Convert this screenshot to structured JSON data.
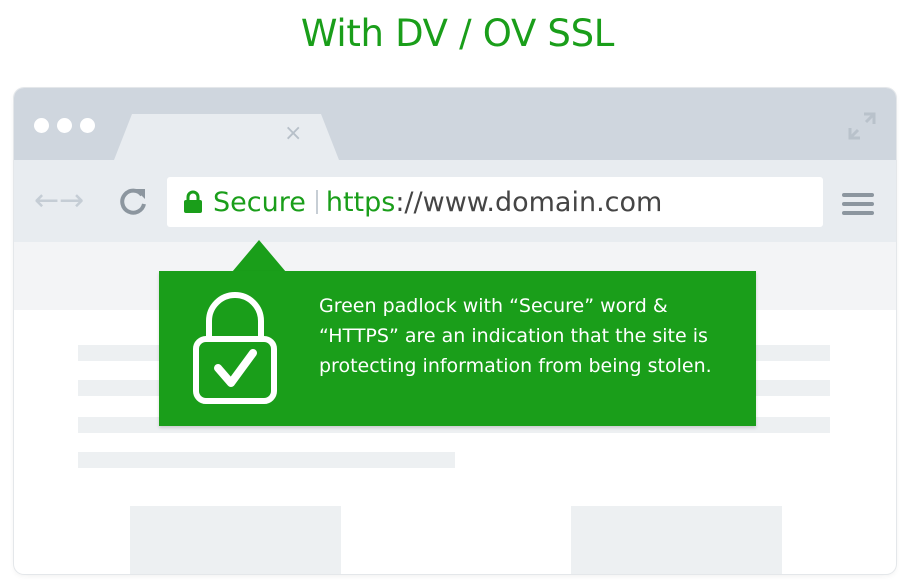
{
  "headline": "With DV / OV SSL",
  "browser": {
    "tab": {
      "close_icon": "close-icon"
    },
    "nav": {
      "back_icon": "arrow-left-icon",
      "forward_icon": "arrow-right-icon",
      "reload_icon": "reload-icon"
    },
    "address_bar": {
      "secure_label": "Secure",
      "url_scheme": "https",
      "url_rest": "://www.domain.com",
      "lock_icon": "padlock-icon"
    },
    "menu_icon": "hamburger-menu-icon",
    "expand_icon": "expand-icon"
  },
  "callout": {
    "text": "Green padlock with “Secure” word & “HTTPS” are an indication that the site is protecting information from being stolen.",
    "icon": "padlock-check-icon"
  },
  "colors": {
    "accent_green": "#1a9e1a",
    "chrome_gray": "#cfd6de",
    "toolbar_gray": "#e8ecf0",
    "placeholder_gray": "#edf0f2"
  }
}
